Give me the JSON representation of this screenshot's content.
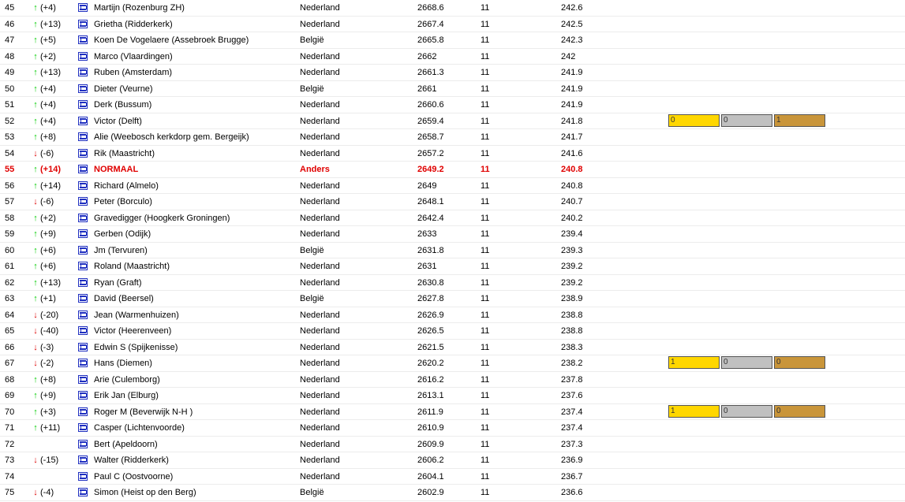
{
  "colors": {
    "up": "#00cc00",
    "down": "#dd0000",
    "highlight": "#e00000",
    "gold": "#ffd700",
    "silver": "#c0c0c0",
    "bronze": "#c9953a",
    "flag": "#1f2fc0"
  },
  "rows": [
    {
      "rank": "45",
      "dir": "up",
      "delta": "(+4)",
      "name": "Martijn (Rozenburg ZH)",
      "country": "Nederland",
      "score": "2668.6",
      "games": "11",
      "avg": "242.6"
    },
    {
      "rank": "46",
      "dir": "up",
      "delta": "(+13)",
      "name": "Grietha (Ridderkerk)",
      "country": "Nederland",
      "score": "2667.4",
      "games": "11",
      "avg": "242.5"
    },
    {
      "rank": "47",
      "dir": "up",
      "delta": "(+5)",
      "name": "Koen De Vogelaere (Assebroek Brugge)",
      "country": "België",
      "score": "2665.8",
      "games": "11",
      "avg": "242.3"
    },
    {
      "rank": "48",
      "dir": "up",
      "delta": "(+2)",
      "name": "Marco (Vlaardingen)",
      "country": "Nederland",
      "score": "2662",
      "games": "11",
      "avg": "242"
    },
    {
      "rank": "49",
      "dir": "up",
      "delta": "(+13)",
      "name": "Ruben (Amsterdam)",
      "country": "Nederland",
      "score": "2661.3",
      "games": "11",
      "avg": "241.9"
    },
    {
      "rank": "50",
      "dir": "up",
      "delta": "(+4)",
      "name": "Dieter (Veurne)",
      "country": "België",
      "score": "2661",
      "games": "11",
      "avg": "241.9"
    },
    {
      "rank": "51",
      "dir": "up",
      "delta": "(+4)",
      "name": "Derk (Bussum)",
      "country": "Nederland",
      "score": "2660.6",
      "games": "11",
      "avg": "241.9"
    },
    {
      "rank": "52",
      "dir": "up",
      "delta": "(+4)",
      "name": "Victor (Delft)",
      "country": "Nederland",
      "score": "2659.4",
      "games": "11",
      "avg": "241.8",
      "medals": [
        "0",
        "0",
        "1"
      ]
    },
    {
      "rank": "53",
      "dir": "up",
      "delta": "(+8)",
      "name": "Alie (Weebosch kerkdorp gem. Bergeijk)",
      "country": "Nederland",
      "score": "2658.7",
      "games": "11",
      "avg": "241.7"
    },
    {
      "rank": "54",
      "dir": "down",
      "delta": "(-6)",
      "name": "Rik (Maastricht)",
      "country": "Nederland",
      "score": "2657.2",
      "games": "11",
      "avg": "241.6"
    },
    {
      "rank": "55",
      "dir": "up",
      "delta": "(+14)",
      "name": "NORMAAL",
      "country": "Anders",
      "score": "2649.2",
      "games": "11",
      "avg": "240.8",
      "highlight": true
    },
    {
      "rank": "56",
      "dir": "up",
      "delta": "(+14)",
      "name": "Richard (Almelo)",
      "country": "Nederland",
      "score": "2649",
      "games": "11",
      "avg": "240.8"
    },
    {
      "rank": "57",
      "dir": "down",
      "delta": "(-6)",
      "name": "Peter (Borculo)",
      "country": "Nederland",
      "score": "2648.1",
      "games": "11",
      "avg": "240.7"
    },
    {
      "rank": "58",
      "dir": "up",
      "delta": "(+2)",
      "name": "Gravedigger (Hoogkerk Groningen)",
      "country": "Nederland",
      "score": "2642.4",
      "games": "11",
      "avg": "240.2"
    },
    {
      "rank": "59",
      "dir": "up",
      "delta": "(+9)",
      "name": "Gerben (Odijk)",
      "country": "Nederland",
      "score": "2633",
      "games": "11",
      "avg": "239.4"
    },
    {
      "rank": "60",
      "dir": "up",
      "delta": "(+6)",
      "name": "Jm (Tervuren)",
      "country": "België",
      "score": "2631.8",
      "games": "11",
      "avg": "239.3"
    },
    {
      "rank": "61",
      "dir": "up",
      "delta": "(+6)",
      "name": "Roland (Maastricht)",
      "country": "Nederland",
      "score": "2631",
      "games": "11",
      "avg": "239.2"
    },
    {
      "rank": "62",
      "dir": "up",
      "delta": "(+13)",
      "name": "Ryan (Graft)",
      "country": "Nederland",
      "score": "2630.8",
      "games": "11",
      "avg": "239.2"
    },
    {
      "rank": "63",
      "dir": "up",
      "delta": "(+1)",
      "name": "David (Beersel)",
      "country": "België",
      "score": "2627.8",
      "games": "11",
      "avg": "238.9"
    },
    {
      "rank": "64",
      "dir": "down",
      "delta": "(-20)",
      "name": "Jean (Warmenhuizen)",
      "country": "Nederland",
      "score": "2626.9",
      "games": "11",
      "avg": "238.8"
    },
    {
      "rank": "65",
      "dir": "down",
      "delta": "(-40)",
      "name": "Victor (Heerenveen)",
      "country": "Nederland",
      "score": "2626.5",
      "games": "11",
      "avg": "238.8"
    },
    {
      "rank": "66",
      "dir": "down",
      "delta": "(-3)",
      "name": "Edwin S (Spijkenisse)",
      "country": "Nederland",
      "score": "2621.5",
      "games": "11",
      "avg": "238.3"
    },
    {
      "rank": "67",
      "dir": "down",
      "delta": "(-2)",
      "name": "Hans (Diemen)",
      "country": "Nederland",
      "score": "2620.2",
      "games": "11",
      "avg": "238.2",
      "medals": [
        "1",
        "0",
        "0"
      ]
    },
    {
      "rank": "68",
      "dir": "up",
      "delta": "(+8)",
      "name": "Arie (Culemborg)",
      "country": "Nederland",
      "score": "2616.2",
      "games": "11",
      "avg": "237.8"
    },
    {
      "rank": "69",
      "dir": "up",
      "delta": "(+9)",
      "name": "Erik Jan (Elburg)",
      "country": "Nederland",
      "score": "2613.1",
      "games": "11",
      "avg": "237.6"
    },
    {
      "rank": "70",
      "dir": "up",
      "delta": "(+3)",
      "name": "Roger M (Beverwijk N-H )",
      "country": "Nederland",
      "score": "2611.9",
      "games": "11",
      "avg": "237.4",
      "medals": [
        "1",
        "0",
        "0"
      ]
    },
    {
      "rank": "71",
      "dir": "up",
      "delta": "(+11)",
      "name": "Casper (Lichtenvoorde)",
      "country": "Nederland",
      "score": "2610.9",
      "games": "11",
      "avg": "237.4"
    },
    {
      "rank": "72",
      "dir": "",
      "delta": "",
      "name": "Bert (Apeldoorn)",
      "country": "Nederland",
      "score": "2609.9",
      "games": "11",
      "avg": "237.3"
    },
    {
      "rank": "73",
      "dir": "down",
      "delta": "(-15)",
      "name": "Walter (Ridderkerk)",
      "country": "Nederland",
      "score": "2606.2",
      "games": "11",
      "avg": "236.9"
    },
    {
      "rank": "74",
      "dir": "",
      "delta": "",
      "name": "Paul C (Oostvoorne)",
      "country": "Nederland",
      "score": "2604.1",
      "games": "11",
      "avg": "236.7"
    },
    {
      "rank": "75",
      "dir": "down",
      "delta": "(-4)",
      "name": "Simon (Heist op den Berg)",
      "country": "België",
      "score": "2602.9",
      "games": "11",
      "avg": "236.6"
    }
  ]
}
